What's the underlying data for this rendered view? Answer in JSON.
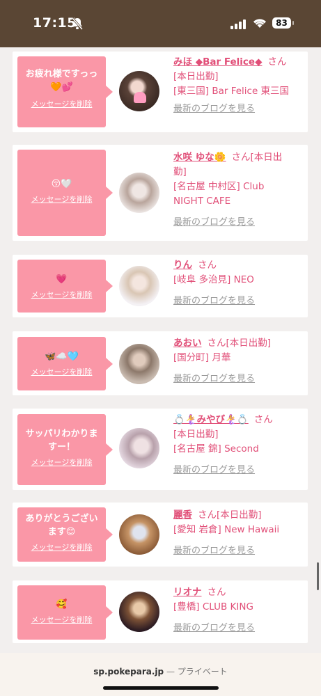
{
  "status_bar": {
    "time": "17:15",
    "battery": "83"
  },
  "colors": {
    "bubble": "#fa97a7",
    "name_text": "#e14f78",
    "header": "#5a4634"
  },
  "messages": [
    {
      "bubble_text": "お疲れ様ですっっ",
      "bubble_emoji": "🧡💕",
      "delete_label": "メッセージを削除",
      "name": "みほ ◆Bar Felice◆",
      "honorific": "さん",
      "details": [
        "[本日出勤]",
        "[東三国] Bar Felice 東三国"
      ],
      "blog_link": "最新のブログを見る"
    },
    {
      "bubble_text": "",
      "bubble_emoji": "😚🤍",
      "delete_label": "メッセージを削除",
      "name": "水咲 ゆな🌼",
      "honorific": "さん[本日出",
      "details": [
        "勤]",
        "[名古屋 中村区] Club",
        "NIGHT CAFE"
      ],
      "blog_link": "最新のブログを見る"
    },
    {
      "bubble_text": "",
      "bubble_emoji": "💗",
      "delete_label": "メッセージを削除",
      "name": "りん",
      "honorific": "さん",
      "details": [
        "[岐阜 多治見] NEO"
      ],
      "blog_link": "最新のブログを見る"
    },
    {
      "bubble_text": "",
      "bubble_emoji": "🦋☁️🩵",
      "delete_label": "メッセージを削除",
      "name": "あおい",
      "honorific": "さん[本日出勤]",
      "details": [
        "[国分町] 月華"
      ],
      "blog_link": "最新のブログを見る"
    },
    {
      "bubble_text": "サッパリわかりま すー！",
      "bubble_emoji": "",
      "delete_label": "メッセージを削除",
      "name": "💍🧜‍♀️みやび🧜‍♀️💍",
      "honorific": "さん",
      "details": [
        "[本日出勤]",
        "[名古屋 錦] Second"
      ],
      "blog_link": "最新のブログを見る"
    },
    {
      "bubble_text": "ありがとうござい ます",
      "bubble_emoji": "😊",
      "delete_label": "メッセージを削除",
      "name": "麗香",
      "honorific": "さん[本日出勤]",
      "details": [
        "[愛知 岩倉] New Hawaii"
      ],
      "blog_link": "最新のブログを見る"
    },
    {
      "bubble_text": "",
      "bubble_emoji": "🥰",
      "delete_label": "メッセージを削除",
      "name": "リオナ",
      "honorific": "さん",
      "details": [
        "[豊橋] CLUB KING"
      ],
      "blog_link": "最新のブログを見る"
    }
  ],
  "browser": {
    "domain": "sp.pokepara.jp",
    "mode": "— プライベート"
  }
}
